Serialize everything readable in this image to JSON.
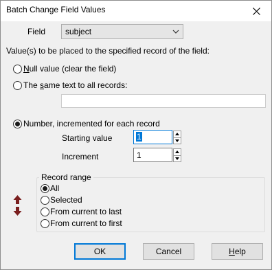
{
  "window": {
    "title": "Batch Change Field Values"
  },
  "field": {
    "label": "Field",
    "value": "subject"
  },
  "instructions": "Value(s) to be placed to the specified record of the field:",
  "options": {
    "null_value": {
      "underlined": "N",
      "rest": "ull value (clear the field)",
      "checked": false
    },
    "same_text": {
      "before": "The ",
      "underlined": "s",
      "after": "ame text to all records:",
      "checked": false,
      "value": ""
    },
    "number_inc": {
      "label": "Number, incremented for each record",
      "checked": true
    }
  },
  "starting_value": {
    "label": "Starting value",
    "value": "1"
  },
  "increment": {
    "label": "Increment",
    "value": "1"
  },
  "record_range": {
    "legend": "Record range",
    "items": [
      {
        "label": "All",
        "checked": true
      },
      {
        "label": "Selected",
        "checked": false
      },
      {
        "label": "From current to last",
        "checked": false
      },
      {
        "label": "From current to first",
        "checked": false
      }
    ]
  },
  "buttons": {
    "ok": "OK",
    "cancel": "Cancel",
    "help_underlined": "H",
    "help_rest": "elp"
  },
  "colors": {
    "focus_border": "#0078d7",
    "arrow_icon": "#7a1f1f"
  },
  "icons": [
    "close-icon",
    "chevron-down-icon",
    "spin-up-icon",
    "spin-down-icon",
    "up-down-arrows-icon"
  ]
}
